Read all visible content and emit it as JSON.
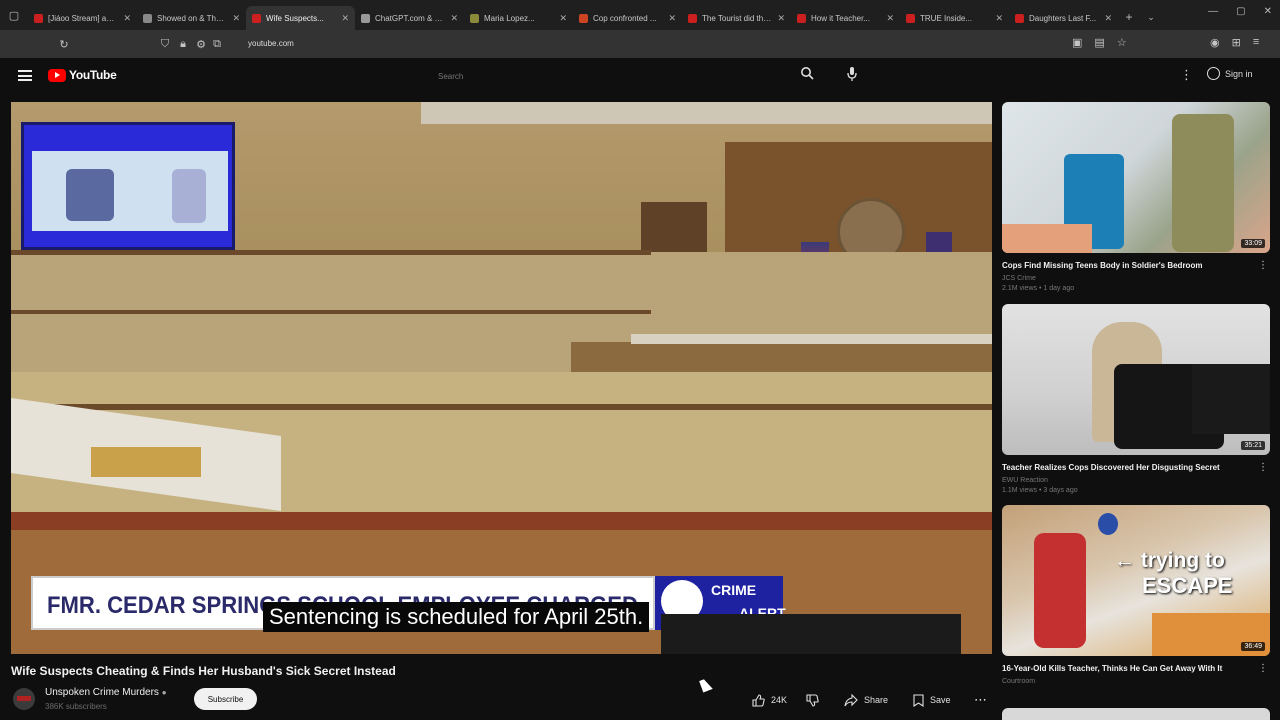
{
  "browser": {
    "tabs": [
      {
        "title": "[Jiáoo Stream] aoo...",
        "fav": "#cc1f1f",
        "active": false
      },
      {
        "title": "Showed on & Thow...",
        "fav": "#888888",
        "active": false
      },
      {
        "title": "Wife Suspects...",
        "fav": "#cc1f1f",
        "active": true
      },
      {
        "title": "ChatGPT.com & To...",
        "fav": "#999999",
        "active": false
      },
      {
        "title": "Maria Lopez...",
        "fav": "#8a8a3a",
        "active": false
      },
      {
        "title": "Cop confronted ...",
        "fav": "#cc4422",
        "active": false
      },
      {
        "title": "The Tourist did the...",
        "fav": "#cc1f1f",
        "active": false
      },
      {
        "title": "How it Teacher...",
        "fav": "#cc1f1f",
        "active": false
      },
      {
        "title": "TRUE Inside...",
        "fav": "#cc1f1f",
        "active": false
      },
      {
        "title": "Daughters Last F...",
        "fav": "#cc1f1f",
        "active": false
      }
    ],
    "url": "youtube.com"
  },
  "header": {
    "logo_text": "YouTube",
    "search_placeholder": "Search",
    "signin_label": "Sign in"
  },
  "player": {
    "chyron": "FMR. CEDAR SPRINGS SCHOOL EMPLOYEE CHARGED",
    "crime_line1": "CRIME",
    "crime_line2": "ALERT",
    "caption": "Sentencing is scheduled for April 25th."
  },
  "video": {
    "title": "Wife Suspects Cheating & Finds Her Husband's Sick Secret Instead",
    "channel": "Unspoken Crime Murders",
    "subscribers": "386K subscribers",
    "subscribe_label": "Subscribe",
    "likes": "24K",
    "share_label": "Share",
    "save_label": "Save"
  },
  "sidebar": {
    "items": [
      {
        "title": "Cops Find Missing Teens Body in Soldier's Bedroom",
        "channel": "JCS Crime",
        "meta": "2.1M views • 1 day ago",
        "duration": "33:09"
      },
      {
        "title": "Teacher Realizes Cops Discovered Her Disgusting Secret",
        "channel": "EWU Reaction",
        "meta": "1.1M views • 3 days ago",
        "duration": "35:21"
      },
      {
        "title": "16-Year-Old Kills Teacher, Thinks He Can Get Away With It",
        "channel": "Courtroom",
        "meta": "",
        "duration": "36:49",
        "overlay1": "← trying to",
        "overlay2": "ESCAPE"
      }
    ]
  }
}
